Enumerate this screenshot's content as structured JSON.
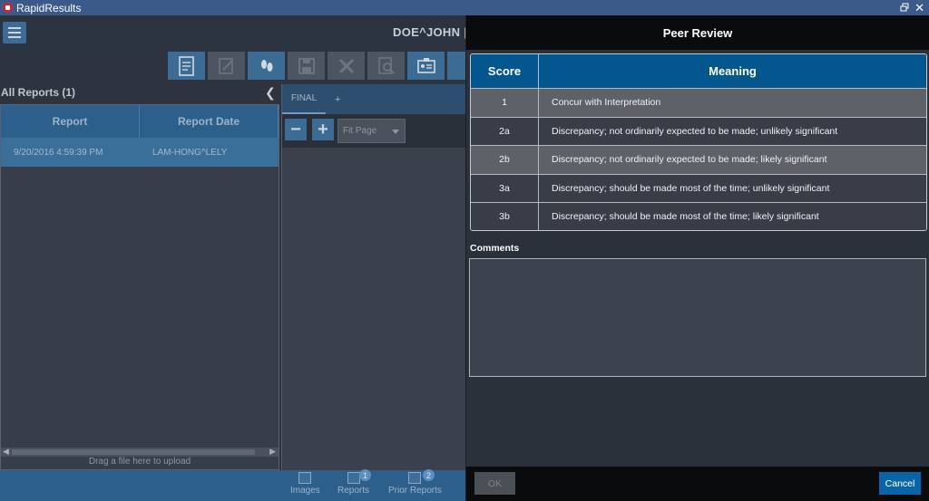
{
  "window": {
    "title": "RapidResults"
  },
  "header": {
    "patient_name": "DOE^JOHN |"
  },
  "toolbar": {
    "icons": [
      "report-icon",
      "edit-icon",
      "footprint-icon",
      "save-icon",
      "delete-icon",
      "search-doc-icon",
      "id-card-icon",
      "overflow-icon"
    ]
  },
  "reports_panel": {
    "title": "All Reports (1)",
    "columns": [
      "Report",
      "Report Date"
    ],
    "rows": [
      [
        "9/20/2016 4:59:39 PM",
        "LAM-HONG^LELY"
      ]
    ],
    "drag_hint": "Drag a file here to upload"
  },
  "viewer": {
    "tabs": [
      "FINAL",
      "+"
    ],
    "fit_select_value": "Fit Page"
  },
  "bottom_tabs": [
    {
      "label": "Images",
      "badge": ""
    },
    {
      "label": "Reports",
      "badge": "1"
    },
    {
      "label": "Prior Reports",
      "badge": "2"
    }
  ],
  "dialog": {
    "title": "Peer Review",
    "table": {
      "headers": [
        "Score",
        "Meaning"
      ],
      "rows": [
        {
          "score": "1",
          "meaning": "Concur with Interpretation"
        },
        {
          "score": "2a",
          "meaning": "Discrepancy; not ordinarily expected to be made; unlikely significant"
        },
        {
          "score": "2b",
          "meaning": "Discrepancy; not ordinarily expected to be made; likely significant"
        },
        {
          "score": "3a",
          "meaning": "Discrepancy; should be made most of the time; unlikely significant"
        },
        {
          "score": "3b",
          "meaning": "Discrepancy; should be made most of the time; likely significant"
        }
      ]
    },
    "comments_label": "Comments",
    "comments_value": "",
    "ok_label": "OK",
    "cancel_label": "Cancel"
  },
  "colors": {
    "accent": "#04568f",
    "title_bar": "#3b5a8a",
    "dialog_header": "#0a0b0d",
    "cancel_button": "#0a65a8"
  }
}
